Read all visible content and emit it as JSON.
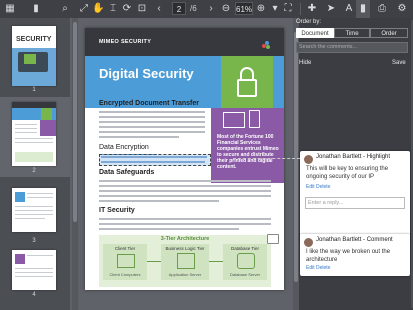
{
  "toolbar": {
    "page_current": "2",
    "page_total": "/6",
    "zoom": "61%"
  },
  "thumbnails": {
    "page1_title": "SECURITY",
    "page1_label": "1",
    "page2_label": "2",
    "page3_label": "3",
    "page4_label": "4"
  },
  "document": {
    "header": "MIMEO SECURITY",
    "title": "Digital Security",
    "section1": "Encrypted Document Transfer",
    "section2": "Data Encryption",
    "section3": "Data Safeguards",
    "section4": "IT Security",
    "callout": "Most of the Fortune 100 Financial Services companies entrust Mimeo to secure and distribute their printed and digital content.",
    "arch_title": "3-Tier Architecture",
    "tier1": "Client Tier",
    "tier2": "Business Logic Tier",
    "tier3": "Database Tier",
    "tier1_sub": "Client Computers",
    "tier2_sub": "Application Server",
    "tier3_sub": "Database Server"
  },
  "panel": {
    "order_by": "Order by:",
    "sort_options": [
      "Document",
      "Time",
      "Order"
    ],
    "search_placeholder": "Search the comments...",
    "hide_label": "Hide",
    "save_label": "Save"
  },
  "comments": [
    {
      "author": "Jonathan Bartlett - Highlight",
      "text": "This will be key to ensuring the ongoing security of our IP",
      "actions": "Edit  Delete",
      "reply_placeholder": "Enter a reply..."
    },
    {
      "author": "Jonathan Bartlett - Comment",
      "text": "I like the way we broken out the architecture",
      "actions": "Edit  Delete"
    }
  ],
  "colors": {
    "accent_blue": "#4c9cd7",
    "accent_green": "#78b64b",
    "accent_purple": "#8b5aa6",
    "toolbar_bg": "#3e4045"
  }
}
